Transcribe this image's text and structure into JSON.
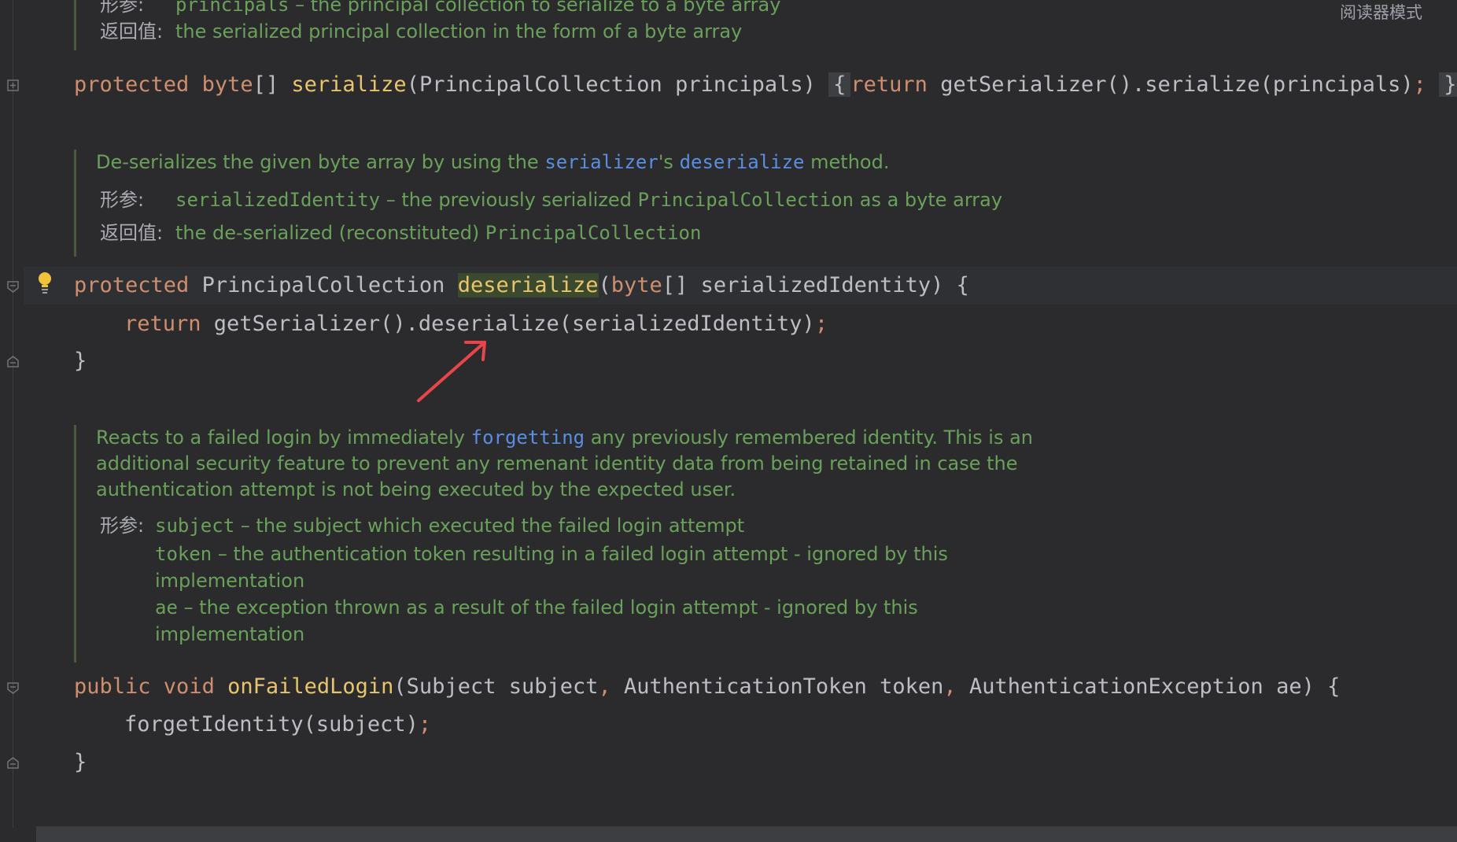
{
  "reader_mode_label": "阅读器模式",
  "labels": {
    "param": "形参:",
    "returns": "返回值:"
  },
  "top_doc": {
    "param_name": "principals",
    "param_desc": " – the principal collection to serialize to a byte array",
    "returns_desc": "the serialized principal collection in the form of a byte array"
  },
  "serialize_line": {
    "kw1": "protected",
    "type": "byte",
    "brackets": "[] ",
    "name": "serialize",
    "params": "(PrincipalCollection principals)",
    "open": "{",
    "ret": "return",
    "body": " getSerializer().serialize(principals)",
    "semi": ";",
    "close": "}"
  },
  "deser_doc": {
    "desc_pre": "De-serializes the given byte array by using the ",
    "link1": "serializer",
    "desc_mid": "'s ",
    "link2": "deserialize",
    "desc_post": " method.",
    "param_name": "serializedIdentity",
    "param_mid": " – the previously serialized ",
    "param_type": "PrincipalCollection",
    "param_post": " as a byte array",
    "returns_pre": "the de-serialized (reconstituted) ",
    "returns_type": "PrincipalCollection"
  },
  "deser_sig": {
    "kw": "protected",
    "type": " PrincipalCollection ",
    "name": "deserialize",
    "p_open": "(",
    "p_type": "byte",
    "p_rest": "[] serializedIdentity) {"
  },
  "deser_body": {
    "ret": "return",
    "call": " getSerializer().deserialize(serializedIdentity)",
    "semi": ";"
  },
  "close_brace": "}",
  "failed_doc": {
    "line1_pre": "Reacts to a failed login by immediately ",
    "line1_link": "forgetting",
    "line1_post": " any previously remembered identity. This is an",
    "line2": "additional security feature to prevent any remenant identity data from being retained in case the",
    "line3": "authentication attempt is not being executed by the expected user.",
    "p1_name": "subject",
    "p1_desc": " – the subject which executed the failed login attempt",
    "p2_name": "token",
    "p2_desc": " – the authentication token resulting in a failed login attempt - ignored by this",
    "p2_cont": "implementation",
    "p3_name": "ae",
    "p3_desc": " – the exception thrown as a result of the failed login attempt - ignored by this",
    "p3_cont": "implementation"
  },
  "failed_sig": {
    "kw1": "public",
    "kw2": " void ",
    "name": "onFailedLogin",
    "a1": "(Subject subject",
    "c1": ",",
    "a2": " AuthenticationToken token",
    "c2": ",",
    "a3": " AuthenticationException ae) {"
  },
  "failed_body": {
    "call": "forgetIdentity(subject)",
    "semi": ";"
  },
  "icons": [
    "fold-icon",
    "lightbulb-icon",
    "arrow-annotation"
  ]
}
